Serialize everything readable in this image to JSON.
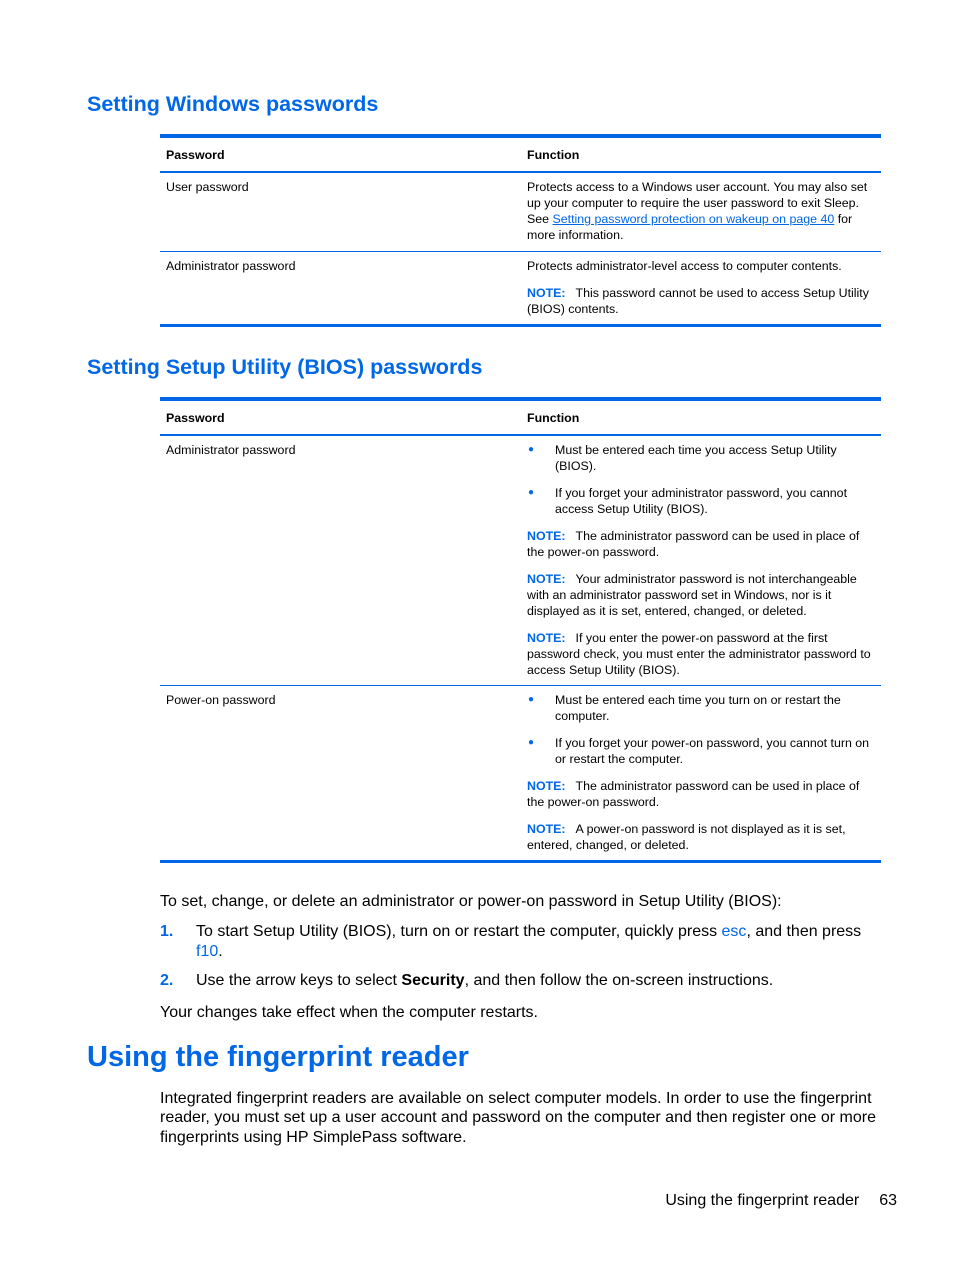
{
  "sections": {
    "windows": {
      "title": "Setting Windows passwords",
      "headers": [
        "Password",
        "Function"
      ],
      "rows": [
        {
          "password": "User password",
          "function_text_before": "Protects access to a Windows user account. You may also set up your computer to require the user password to exit Sleep. See ",
          "link_text": "Setting password protection on wakeup on page 40",
          "function_text_after": " for more information."
        },
        {
          "password": "Administrator password",
          "function_text": "Protects administrator-level access to computer contents.",
          "note_label": "NOTE:",
          "note_text": "This password cannot be used to access Setup Utility (BIOS) contents."
        }
      ]
    },
    "bios": {
      "title": "Setting Setup Utility (BIOS) passwords",
      "headers": [
        "Password",
        "Function"
      ],
      "rows": [
        {
          "password": "Administrator password",
          "bullets": [
            "Must be entered each time you access Setup Utility (BIOS).",
            "If you forget your administrator password, you cannot access Setup Utility (BIOS)."
          ],
          "notes": [
            {
              "label": "NOTE:",
              "text": "The administrator password can be used in place of the power-on password."
            },
            {
              "label": "NOTE:",
              "text": "Your administrator password is not interchangeable with an administrator password set in Windows, nor is it displayed as it is set, entered, changed, or deleted."
            },
            {
              "label": "NOTE:",
              "text": "If you enter the power-on password at the first password check, you must enter the administrator password to access Setup Utility (BIOS)."
            }
          ]
        },
        {
          "password": "Power-on password",
          "bullets": [
            "Must be entered each time you turn on or restart the computer.",
            "If you forget your power-on password, you cannot turn on or restart the computer."
          ],
          "notes": [
            {
              "label": "NOTE:",
              "text": "The administrator password can be used in place of the power-on password."
            },
            {
              "label": "NOTE:",
              "text": "A power-on password is not displayed as it is set, entered, changed, or deleted."
            }
          ]
        }
      ]
    }
  },
  "procedure": {
    "intro": "To set, change, or delete an administrator or power-on password in Setup Utility (BIOS):",
    "steps": [
      {
        "number": "1.",
        "text_before": "To start Setup Utility (BIOS), turn on or restart the computer, quickly press ",
        "key1": "esc",
        "text_middle": ", and then press ",
        "key2": "f10",
        "text_after": "."
      },
      {
        "number": "2.",
        "text_before": "Use the arrow keys to select ",
        "bold": "Security",
        "text_after": ", and then follow the on-screen instructions."
      }
    ],
    "outro": "Your changes take effect when the computer restarts."
  },
  "fingerprint": {
    "title": "Using the fingerprint reader",
    "body": "Integrated fingerprint readers are available on select computer models. In order to use the fingerprint reader, you must set up a user account and password on the computer and then register one or more fingerprints using HP SimplePass software."
  },
  "footer": {
    "section": "Using the fingerprint reader",
    "page": "63"
  },
  "colors": {
    "accent": "#0067e6"
  }
}
